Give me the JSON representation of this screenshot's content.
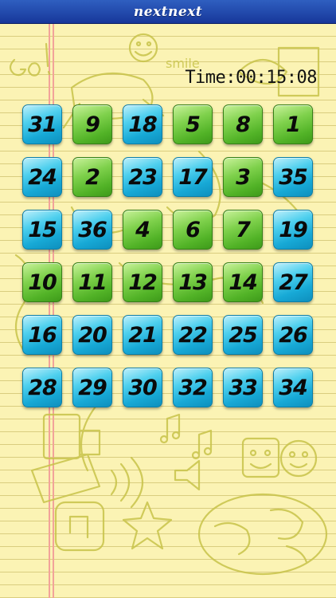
{
  "header": {
    "title": "nextnext"
  },
  "timer": {
    "text": "Time:00:15:08"
  },
  "doodle_text": "smile",
  "tile_colors": {
    "blue": "#17a9d6",
    "green": "#52b327"
  },
  "tiles": [
    {
      "value": "31",
      "color": "blue"
    },
    {
      "value": "9",
      "color": "green"
    },
    {
      "value": "18",
      "color": "blue"
    },
    {
      "value": "5",
      "color": "green"
    },
    {
      "value": "8",
      "color": "green"
    },
    {
      "value": "1",
      "color": "green"
    },
    {
      "value": "24",
      "color": "blue"
    },
    {
      "value": "2",
      "color": "green"
    },
    {
      "value": "23",
      "color": "blue"
    },
    {
      "value": "17",
      "color": "blue"
    },
    {
      "value": "3",
      "color": "green"
    },
    {
      "value": "35",
      "color": "blue"
    },
    {
      "value": "15",
      "color": "blue"
    },
    {
      "value": "36",
      "color": "blue"
    },
    {
      "value": "4",
      "color": "green"
    },
    {
      "value": "6",
      "color": "green"
    },
    {
      "value": "7",
      "color": "green"
    },
    {
      "value": "19",
      "color": "blue"
    },
    {
      "value": "10",
      "color": "green"
    },
    {
      "value": "11",
      "color": "green"
    },
    {
      "value": "12",
      "color": "green"
    },
    {
      "value": "13",
      "color": "green"
    },
    {
      "value": "14",
      "color": "green"
    },
    {
      "value": "27",
      "color": "blue"
    },
    {
      "value": "16",
      "color": "blue"
    },
    {
      "value": "20",
      "color": "blue"
    },
    {
      "value": "21",
      "color": "blue"
    },
    {
      "value": "22",
      "color": "blue"
    },
    {
      "value": "25",
      "color": "blue"
    },
    {
      "value": "26",
      "color": "blue"
    },
    {
      "value": "28",
      "color": "blue"
    },
    {
      "value": "29",
      "color": "blue"
    },
    {
      "value": "30",
      "color": "blue"
    },
    {
      "value": "32",
      "color": "blue"
    },
    {
      "value": "33",
      "color": "blue"
    },
    {
      "value": "34",
      "color": "blue"
    }
  ]
}
